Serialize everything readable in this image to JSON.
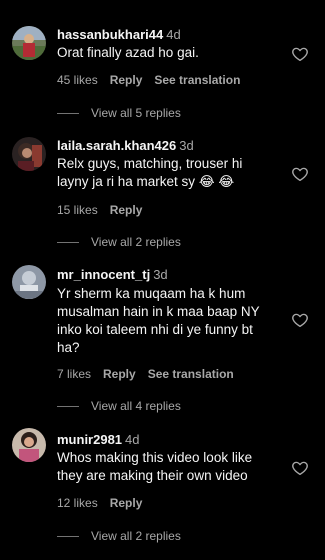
{
  "comments": [
    {
      "username": "hassanbukhari44",
      "time": "4d",
      "text": "Orat finally azad ho gai.",
      "likes": "45 likes",
      "reply": "Reply",
      "translation": "See translation",
      "view_replies": "View all 5 replies",
      "avatar_icon": "avatar-photo"
    },
    {
      "username": "laila.sarah.khan426",
      "time": "3d",
      "text": "Relx guys, matching, trouser hi layny ja ri ha market sy",
      "emoji": "😂 😂",
      "likes": "15 likes",
      "reply": "Reply",
      "view_replies": "View all 2 replies",
      "avatar_icon": "avatar-photo"
    },
    {
      "username": "mr_innocent_tj",
      "time": "3d",
      "text": "Yr sherm ka muqaam ha k hum musalman hain in k maa baap NY inko koi taleem nhi di ye funny bt ha?",
      "likes": "7 likes",
      "reply": "Reply",
      "translation": "See translation",
      "view_replies": "View all 4 replies",
      "avatar_icon": "avatar-photo"
    },
    {
      "username": "munir2981",
      "time": "4d",
      "text": "Whos making this video look like they are making their own video",
      "likes": "12 likes",
      "reply": "Reply",
      "view_replies": "View all 2 replies",
      "avatar_icon": "avatar-photo"
    }
  ],
  "colors": {
    "background": "#000000",
    "primary_text": "#f5f5f5",
    "secondary_text": "#a8a8a8",
    "heart_stroke": "#a8a8a8"
  },
  "icons": {
    "like": "heart-outline-icon"
  }
}
